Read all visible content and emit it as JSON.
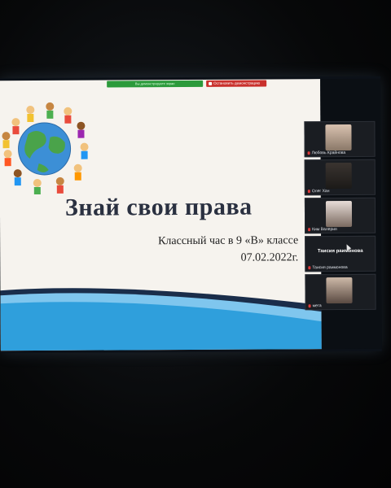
{
  "share_bar": {
    "status": "Вы демонстрируете экран",
    "stop_label": "Остановить демонстрацию"
  },
  "slide": {
    "title": "Знай свои права",
    "subtitle_line1": "Классный час в 9 «В» классе",
    "subtitle_line2": "07.02.2022г."
  },
  "participants": [
    {
      "name": "Любовь Крайнова",
      "has_video": true
    },
    {
      "name": "Олег Хан",
      "has_video": true
    },
    {
      "name": "Ким Валерия",
      "has_video": true
    },
    {
      "name": "Таисия раимонова",
      "has_video": false,
      "center_label": "Таисия раимонова"
    },
    {
      "name": "мета",
      "has_video": true
    }
  ],
  "colors": {
    "slide_bg": "#f6f3ee",
    "title": "#2a3040",
    "wave_blue": "#2f9fdc",
    "wave_dark": "#1a2d4a",
    "share_green": "#2c9a3b",
    "stop_red": "#c9302c"
  }
}
